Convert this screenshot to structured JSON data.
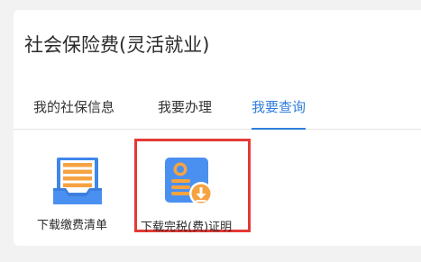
{
  "header": {
    "title": "社会保险费(灵活就业)"
  },
  "tabs": [
    {
      "label": "我的社保信息",
      "active": false
    },
    {
      "label": "我要办理",
      "active": false
    },
    {
      "label": "我要查询",
      "active": true
    }
  ],
  "tiles": [
    {
      "label": "下载缴费清单",
      "icon": "document-tray-icon",
      "selected": false
    },
    {
      "label": "下载完税(费)证明",
      "icon": "certificate-download-icon",
      "selected": true
    }
  ],
  "colors": {
    "accent": "#2f7ddb",
    "selection_border": "#e53935",
    "icon_blue": "#4a90f0",
    "icon_orange": "#f5a341"
  }
}
